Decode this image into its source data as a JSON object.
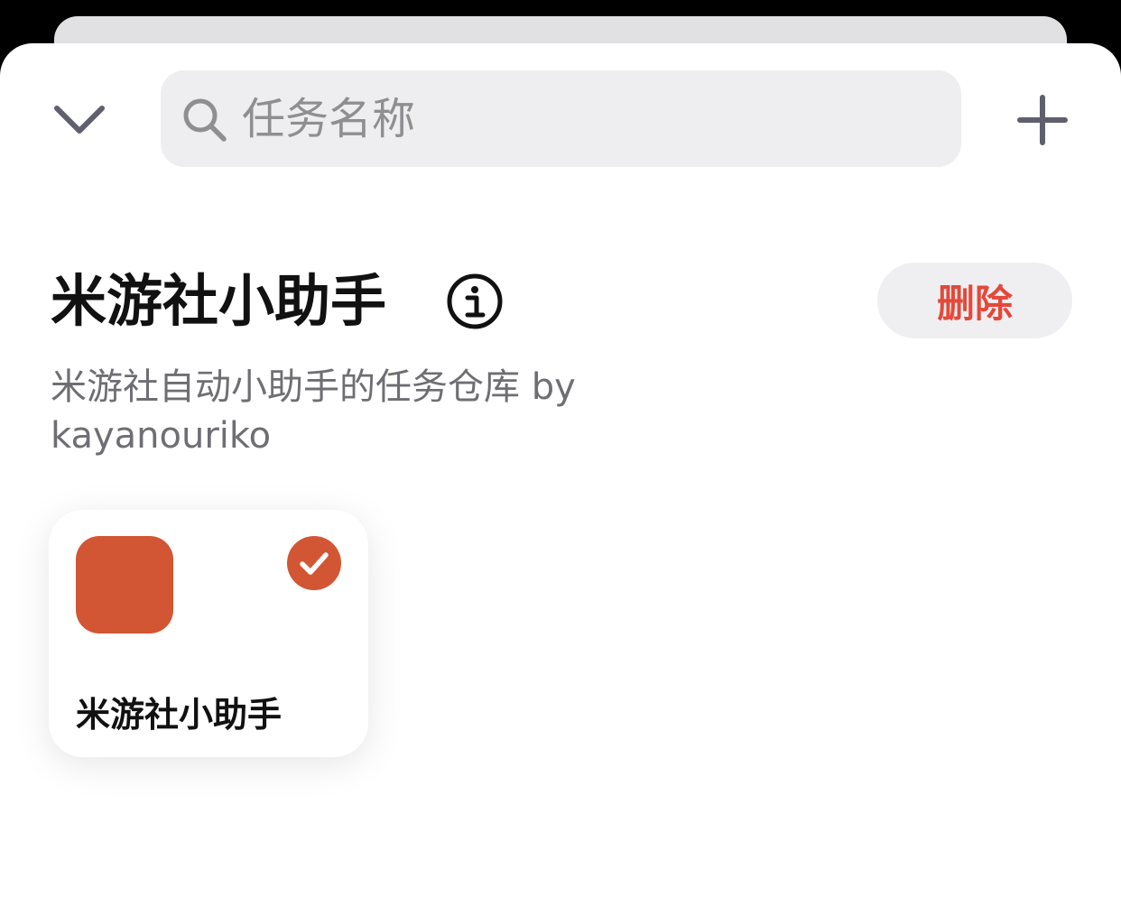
{
  "header": {
    "search_placeholder": "任务名称",
    "collapse_icon": "chevron-down-icon",
    "add_icon": "plus-icon"
  },
  "repository": {
    "title": "米游社小助手",
    "description": "米游社自动小助手的任务仓库 by kayanouriko",
    "delete_label": "删除",
    "info_icon": "info-circle-icon"
  },
  "tasks": [
    {
      "name": "米游社小助手",
      "selected": true,
      "icon_color": "#d35634"
    }
  ],
  "colors": {
    "accent": "#d35634",
    "danger": "#e5483a",
    "search_bg": "#eeeef0",
    "icon_gray": "#5f5f6d"
  }
}
